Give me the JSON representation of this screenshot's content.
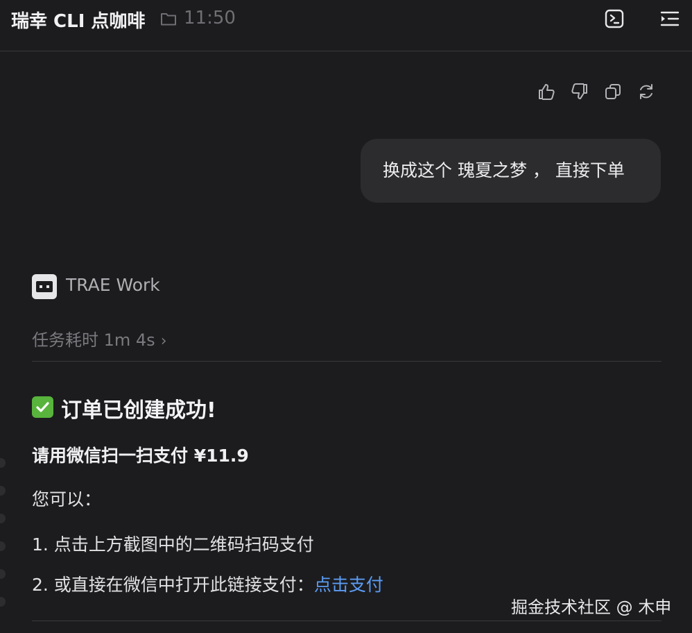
{
  "header": {
    "title": "瑞幸 CLI 点咖啡",
    "folder_icon": "folder-icon",
    "time": "11:50",
    "terminal_icon": "terminal-icon",
    "menu_icon": "sidebar-menu-icon"
  },
  "message_actions": [
    "thumbs-up-icon",
    "thumbs-down-icon",
    "copy-icon",
    "retry-icon"
  ],
  "user_message": "换成这个 瑰夏之梦 ， 直接下单",
  "agent": {
    "name": "TRAE Work",
    "logo_icon": "trae-logo-icon",
    "elapsed": "任务耗时 1m 4s",
    "elapsed_chevron": "›"
  },
  "response": {
    "heading": "订单已创建成功!",
    "pay_line": "请用微信扫一扫支付 ¥11.9",
    "intro": "您可以：",
    "option1": "1. 点击上方截图中的二维码扫码支付",
    "option2_prefix": "2. 或直接在微信中打开此链接支付：",
    "option2_link": "点击支付"
  },
  "watermark": "掘金技术社区 @ 木申",
  "colors": {
    "background": "#1c1c1e",
    "bubble": "#2c2c2f",
    "link": "#5b9cf5",
    "check": "#58b43c"
  }
}
